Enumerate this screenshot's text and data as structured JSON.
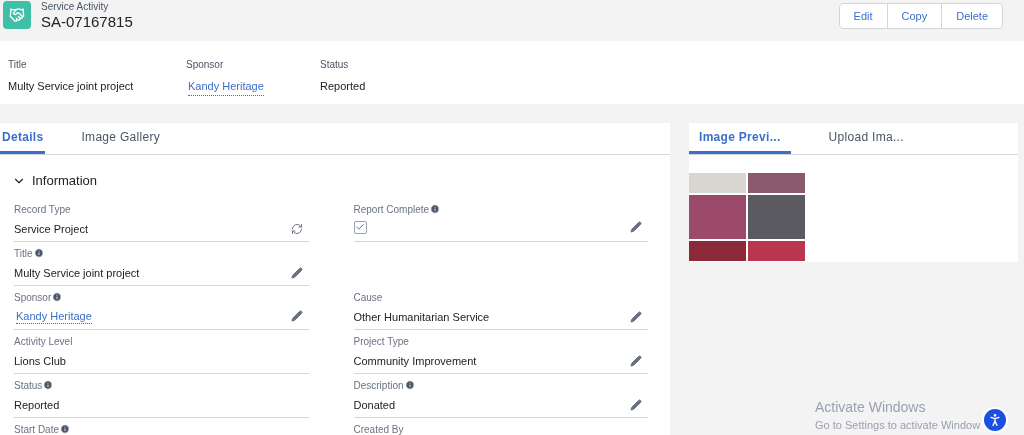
{
  "header": {
    "object_type": "Service Activity",
    "record_name": "SA-07167815",
    "actions": [
      "Edit",
      "Copy",
      "Delete"
    ]
  },
  "highlights": [
    {
      "label": "Title",
      "value": "Multy Service joint project",
      "kind": "text"
    },
    {
      "label": "Sponsor",
      "value": "Kandy Heritage",
      "kind": "link"
    },
    {
      "label": "Status",
      "value": "Reported",
      "kind": "text"
    }
  ],
  "detail_tabs": [
    {
      "label": "Details",
      "selected": true
    },
    {
      "label": "Image Gallery",
      "selected": false
    }
  ],
  "section": {
    "title": "Information",
    "expanded": true
  },
  "left_fields": [
    {
      "kind": "record_type",
      "label": "Record Type",
      "info": false,
      "value": "Service Project"
    },
    {
      "kind": "text",
      "label": "Title",
      "info": true,
      "value": "Multy Service joint project",
      "editable": true
    },
    {
      "kind": "link",
      "label": "Sponsor",
      "info": true,
      "value": "Kandy Heritage",
      "editable": true
    },
    {
      "kind": "text",
      "label": "Activity Level",
      "info": false,
      "value": "Lions Club",
      "editable": false
    },
    {
      "kind": "text",
      "label": "Status",
      "info": true,
      "value": "Reported",
      "editable": false
    },
    {
      "kind": "text",
      "label": "Start Date",
      "info": true
    }
  ],
  "right_fields": [
    {
      "kind": "checkbox",
      "label": "Report Complete",
      "info": true,
      "checked": true,
      "editable": true
    },
    {
      "kind": "empty"
    },
    {
      "kind": "text",
      "label": "Cause",
      "info": false,
      "value": "Other Humanitarian Service",
      "editable": true
    },
    {
      "kind": "text",
      "label": "Project Type",
      "info": false,
      "value": "Community Improvement",
      "editable": true
    },
    {
      "kind": "text",
      "label": "Description",
      "info": true,
      "value": "Donated",
      "editable": true
    },
    {
      "kind": "text",
      "label": "Created By"
    }
  ],
  "preview_tabs": [
    {
      "label": "Image Previ...",
      "selected": true
    },
    {
      "label": "Upload Ima...",
      "selected": false
    }
  ],
  "photos": [
    {
      "color": "#d9d6cf"
    },
    {
      "color": "#8a5a6e"
    },
    {
      "color": "#9c4a6a"
    },
    {
      "color": "#5b5a60"
    },
    {
      "color": "#8c2a3c"
    },
    {
      "color": "#b8374e"
    }
  ],
  "os_notice": {
    "title": "Activate Windows",
    "subtitle": "Go to Settings to activate Window"
  }
}
